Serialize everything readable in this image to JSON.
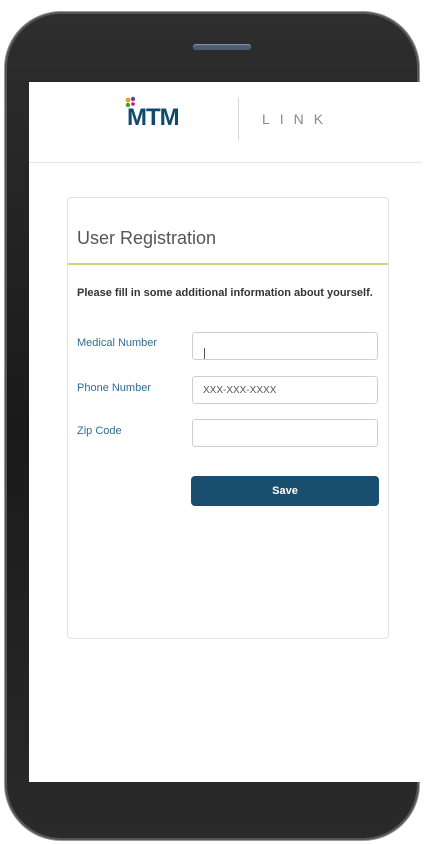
{
  "logo": {
    "brand": "MTM",
    "product": "LINK"
  },
  "form": {
    "title": "User Registration",
    "instruction": "Please fill in some additional information about yourself.",
    "fields": [
      {
        "label": "Medical Number",
        "value": "",
        "placeholder": ""
      },
      {
        "label": "Phone Number",
        "value": "",
        "placeholder": "XXX-XXX-XXXX"
      },
      {
        "label": "Zip Code",
        "value": "",
        "placeholder": ""
      }
    ],
    "save_label": "Save"
  },
  "colors": {
    "brand_navy": "#0d4a6b",
    "label_blue": "#2f6e93",
    "accent_green": "#c6d97a",
    "button_bg": "#1a4e6e"
  }
}
